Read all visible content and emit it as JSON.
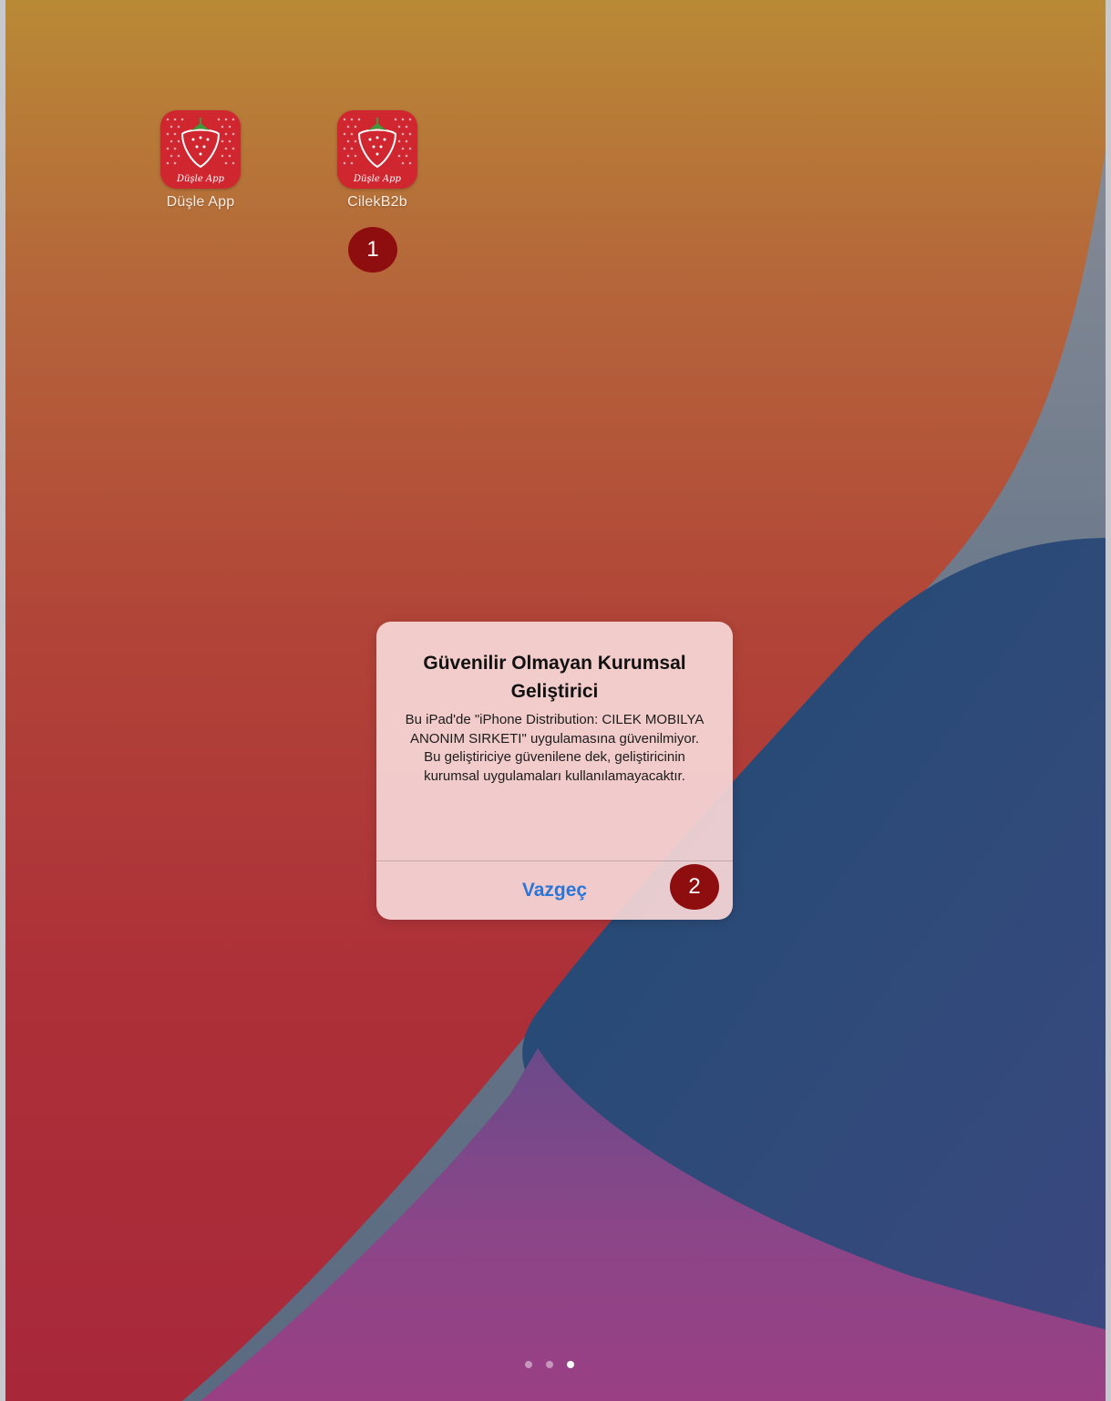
{
  "home_screen": {
    "apps": [
      {
        "label": "Düşle App",
        "icon": "dusle-app-icon",
        "icon_caption": "Düşle App"
      },
      {
        "label": "CilekB2b",
        "icon": "cilekb2b-icon",
        "icon_caption": "Düşle App"
      }
    ],
    "page_indicator": {
      "pages": 3,
      "current": 3
    }
  },
  "annotations": {
    "step1": "1",
    "step2": "2",
    "badge_color": "#8e0d0f"
  },
  "alert": {
    "title": "Güvenilir Olmayan Kurumsal Geliştirici",
    "message": "Bu iPad'de \"iPhone Distribution: CILEK MOBILYA ANONIM SIRKETI\" uygulamasına güvenilmiyor. Bu geliştiriciye güvenilene dek, geliştiricinin kurumsal uygulamaları kullanılamayacaktır.",
    "cancel_label": "Vazgeç",
    "button_color": "#2a76d8"
  }
}
